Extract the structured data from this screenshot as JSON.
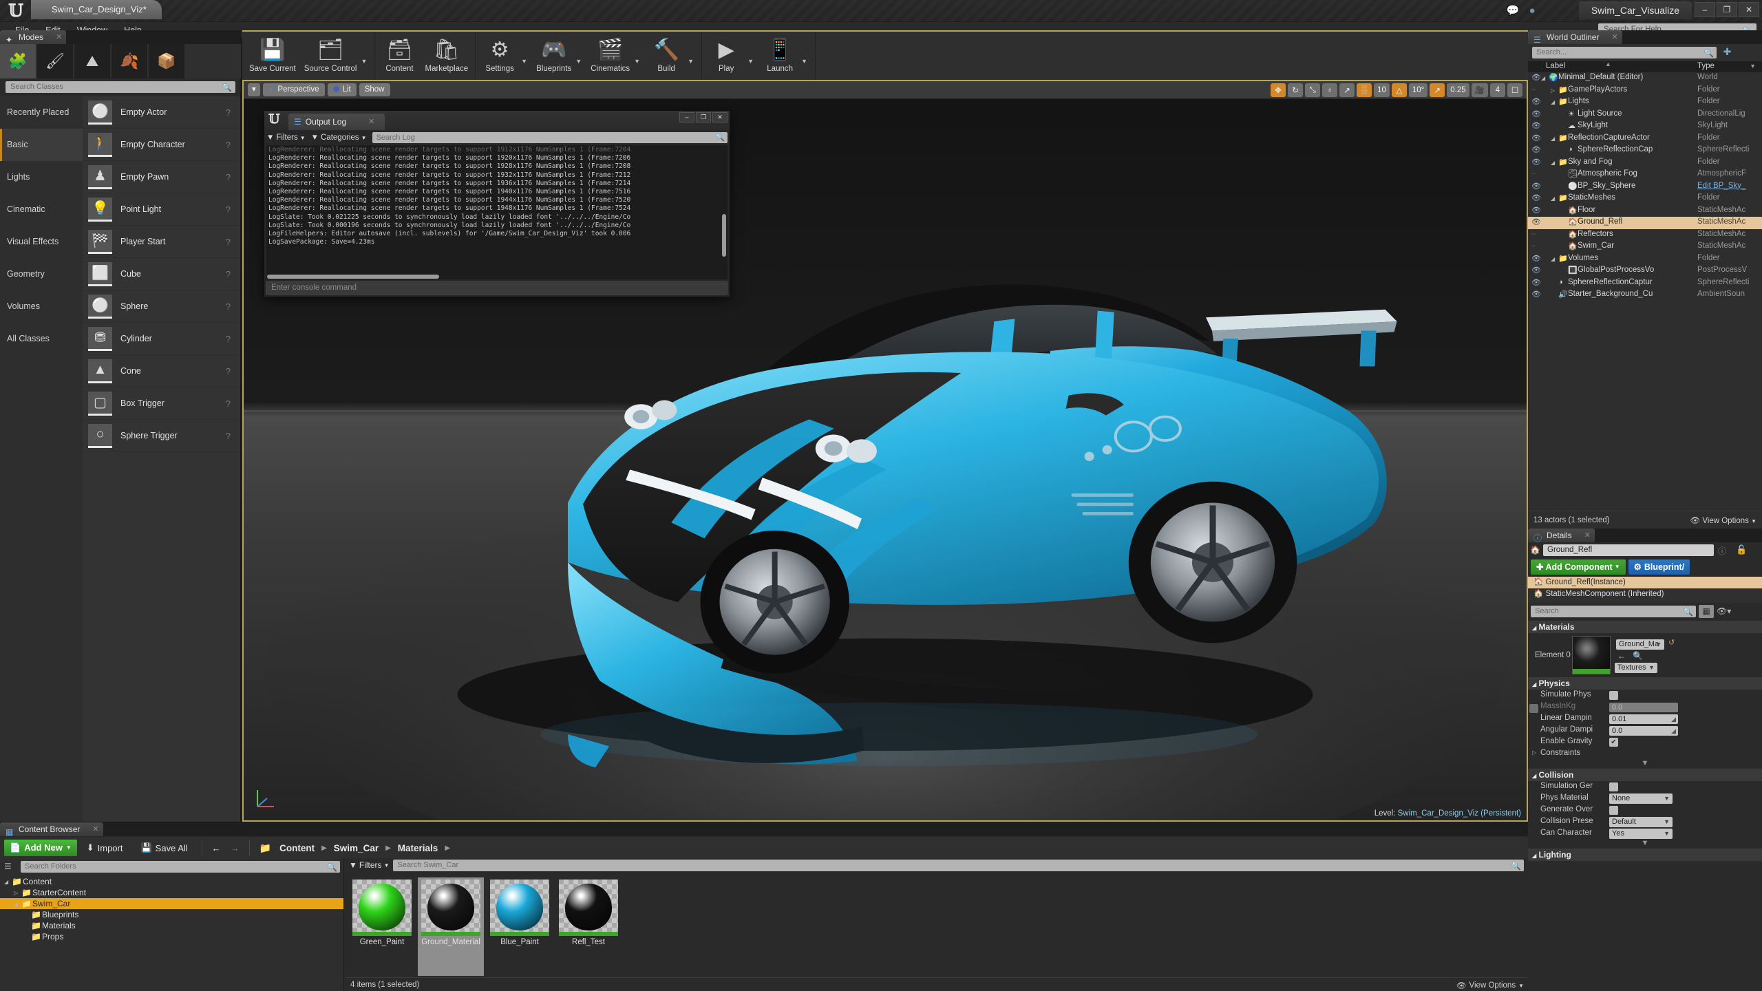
{
  "titlebar": {
    "project_tab": "Swim_Car_Design_Viz*",
    "app_tab": "Swim_Car_Visualize",
    "chat_icon": "speech-bubble-icon",
    "layers_icon": "layers-icon",
    "minimize": "–",
    "maximize": "❐",
    "close": "✕"
  },
  "menubar": {
    "items": [
      "File",
      "Edit",
      "Window",
      "Help"
    ],
    "help_search_placeholder": "Search For Help"
  },
  "modes": {
    "tab_label": "Modes",
    "mode_buttons": [
      "place-mode-icon",
      "paint-mode-icon",
      "landscape-mode-icon",
      "foliage-mode-icon",
      "geometry-mode-icon"
    ],
    "selected_mode_index": 0,
    "search_placeholder": "Search Classes",
    "categories": [
      "Recently Placed",
      "Basic",
      "Lights",
      "Cinematic",
      "Visual Effects",
      "Geometry",
      "Volumes",
      "All Classes"
    ],
    "selected_category": "Basic",
    "placeables": [
      {
        "label": "Empty Actor",
        "icon": "sphere-thumb-icon"
      },
      {
        "label": "Empty Character",
        "icon": "character-thumb-icon"
      },
      {
        "label": "Empty Pawn",
        "icon": "pawn-thumb-icon"
      },
      {
        "label": "Point Light",
        "icon": "bulb-thumb-icon"
      },
      {
        "label": "Player Start",
        "icon": "playerstart-thumb-icon"
      },
      {
        "label": "Cube",
        "icon": "cube-thumb-icon"
      },
      {
        "label": "Sphere",
        "icon": "sphere2-thumb-icon"
      },
      {
        "label": "Cylinder",
        "icon": "cylinder-thumb-icon"
      },
      {
        "label": "Cone",
        "icon": "cone-thumb-icon"
      },
      {
        "label": "Box Trigger",
        "icon": "boxtrigger-thumb-icon"
      },
      {
        "label": "Sphere Trigger",
        "icon": "spheretrigger-thumb-icon"
      }
    ]
  },
  "toolbar": {
    "groups": [
      {
        "items": [
          {
            "label": "Save Current",
            "icon": "floppy-disk-icon",
            "arrow": false
          },
          {
            "label": "Source Control",
            "icon": "source-control-icon",
            "arrow": true
          }
        ]
      },
      {
        "items": [
          {
            "label": "Content",
            "icon": "content-icon",
            "arrow": false
          },
          {
            "label": "Marketplace",
            "icon": "marketplace-bag-icon",
            "arrow": false
          }
        ]
      },
      {
        "items": [
          {
            "label": "Settings",
            "icon": "gear-icon",
            "arrow": true
          },
          {
            "label": "Blueprints",
            "icon": "blueprint-icon",
            "arrow": true
          },
          {
            "label": "Cinematics",
            "icon": "clapperboard-icon",
            "arrow": true
          },
          {
            "label": "Build",
            "icon": "build-icon",
            "arrow": true
          }
        ]
      },
      {
        "items": [
          {
            "label": "Play",
            "icon": "play-icon",
            "arrow": true
          },
          {
            "label": "Launch",
            "icon": "launch-icon",
            "arrow": true
          }
        ]
      }
    ]
  },
  "viewport": {
    "perspective_label": "Perspective",
    "lit_label": "Lit",
    "show_label": "Show",
    "menu_arrow": "▾",
    "transform_tools": [
      {
        "name": "translate-tool",
        "glyph": "✥",
        "active": true
      },
      {
        "name": "rotate-tool",
        "glyph": "↻",
        "active": false
      },
      {
        "name": "scale-tool",
        "glyph": "⤡",
        "active": false
      }
    ],
    "coord_system": {
      "name": "world-coord-toggle",
      "glyph": "♁"
    },
    "surface_snap": {
      "name": "surface-snap-toggle",
      "glyph": "↗"
    },
    "grid_snap": {
      "name": "grid-snap-toggle",
      "glyph": "░",
      "active": true
    },
    "grid_value": "10",
    "rotation_snap": {
      "name": "rotation-snap-toggle",
      "glyph": "△",
      "active": true
    },
    "rotation_value": "10°",
    "scale_snap": {
      "name": "scale-snap-toggle",
      "glyph": "↗",
      "active": true
    },
    "scale_value": "0.25",
    "camera_speed_icon": "camera-speed-icon",
    "camera_speed_value": "4",
    "maximize_icon": "maximize-viewport-icon",
    "level_prefix": "Level:",
    "level_name": "Swim_Car_Design_Viz (Persistent)"
  },
  "output_log": {
    "window_title": "Output Log",
    "filters_label": "Filters",
    "categories_label": "Categories",
    "search_placeholder": "Search Log",
    "console_placeholder": "Enter console command",
    "window_buttons": {
      "min": "–",
      "max": "❐",
      "close": "✕"
    },
    "lines": [
      "LogRenderer: Reallocating scene render targets to support 1912x1176 NumSamples 1 (Frame:7204",
      "LogRenderer: Reallocating scene render targets to support 1920x1176 NumSamples 1 (Frame:7206",
      "LogRenderer: Reallocating scene render targets to support 1928x1176 NumSamples 1 (Frame:7208",
      "LogRenderer: Reallocating scene render targets to support 1932x1176 NumSamples 1 (Frame:7212",
      "LogRenderer: Reallocating scene render targets to support 1936x1176 NumSamples 1 (Frame:7214",
      "LogRenderer: Reallocating scene render targets to support 1940x1176 NumSamples 1 (Frame:7516",
      "LogRenderer: Reallocating scene render targets to support 1944x1176 NumSamples 1 (Frame:7520",
      "LogRenderer: Reallocating scene render targets to support 1948x1176 NumSamples 1 (Frame:7524",
      "LogSlate: Took 0.021225 seconds to synchronously load lazily loaded font '../../../Engine/Co",
      "LogSlate: Took 0.000196 seconds to synchronously load lazily loaded font '../../../Engine/Co",
      "LogFileHelpers: Editor autosave (incl. sublevels) for '/Game/Swim_Car_Design_Viz' took 0.006",
      "LogSavePackage: Save=4.23ms"
    ]
  },
  "world_outliner": {
    "tab_label": "World Outliner",
    "search_placeholder": "Search...",
    "add_icon": "add-actor-icon",
    "columns": {
      "label": "Label",
      "type": "Type"
    },
    "rows": [
      {
        "label": "Minimal_Default (Editor)",
        "type": "World",
        "depth": 0,
        "icon": "world-icon",
        "expander": "◢",
        "visible": true,
        "selected": false
      },
      {
        "label": "GamePlayActors",
        "type": "Folder",
        "depth": 1,
        "icon": "folder-icon",
        "expander": "▷",
        "visible": false,
        "selected": false
      },
      {
        "label": "Lights",
        "type": "Folder",
        "depth": 1,
        "icon": "folder-icon",
        "expander": "◢",
        "visible": true,
        "selected": false
      },
      {
        "label": "Light Source",
        "type": "DirectionalLig",
        "depth": 2,
        "icon": "directional-light-icon",
        "expander": "",
        "visible": true,
        "selected": false
      },
      {
        "label": "SkyLight",
        "type": "SkyLight",
        "depth": 2,
        "icon": "sky-light-icon",
        "expander": "",
        "visible": true,
        "selected": false
      },
      {
        "label": "ReflectionCaptureActor",
        "type": "Folder",
        "depth": 1,
        "icon": "folder-icon",
        "expander": "◢",
        "visible": true,
        "selected": false
      },
      {
        "label": "SphereReflectionCap",
        "type": "SphereReflecti",
        "depth": 2,
        "icon": "reflection-capture-icon",
        "expander": "",
        "visible": true,
        "selected": false
      },
      {
        "label": "Sky and Fog",
        "type": "Folder",
        "depth": 1,
        "icon": "folder-icon",
        "expander": "◢",
        "visible": true,
        "selected": false
      },
      {
        "label": "Atmospheric Fog",
        "type": "AtmosphericF",
        "depth": 2,
        "icon": "fog-icon",
        "expander": "",
        "visible": false,
        "selected": false
      },
      {
        "label": "BP_Sky_Sphere",
        "type": "Edit BP_Sky_",
        "depth": 2,
        "icon": "sky-sphere-icon",
        "expander": "",
        "visible": true,
        "selected": false,
        "type_is_link": true
      },
      {
        "label": "StaticMeshes",
        "type": "Folder",
        "depth": 1,
        "icon": "folder-icon",
        "expander": "◢",
        "visible": true,
        "selected": false
      },
      {
        "label": "Floor",
        "type": "StaticMeshAc",
        "depth": 2,
        "icon": "static-mesh-icon",
        "expander": "",
        "visible": true,
        "selected": false
      },
      {
        "label": "Ground_Refl",
        "type": "StaticMeshAc",
        "depth": 2,
        "icon": "static-mesh-icon",
        "expander": "",
        "visible": true,
        "selected": true
      },
      {
        "label": "Reflectors",
        "type": "StaticMeshAc",
        "depth": 2,
        "icon": "static-mesh-icon",
        "expander": "",
        "visible": false,
        "selected": false
      },
      {
        "label": "Swim_Car",
        "type": "StaticMeshAc",
        "depth": 2,
        "icon": "static-mesh-icon",
        "expander": "",
        "visible": false,
        "selected": false
      },
      {
        "label": "Volumes",
        "type": "Folder",
        "depth": 1,
        "icon": "folder-icon",
        "expander": "◢",
        "visible": true,
        "selected": false
      },
      {
        "label": "GlobalPostProcessVo",
        "type": "PostProcessV",
        "depth": 2,
        "icon": "post-process-icon",
        "expander": "",
        "visible": true,
        "selected": false
      },
      {
        "label": "SphereReflectionCaptur",
        "type": "SphereReflecti",
        "depth": 1,
        "icon": "reflection-capture-icon",
        "expander": "",
        "visible": true,
        "selected": false
      },
      {
        "label": "Starter_Background_Cu",
        "type": "AmbientSoun",
        "depth": 1,
        "icon": "ambient-sound-icon",
        "expander": "",
        "visible": true,
        "selected": false
      }
    ],
    "footer_count": "13 actors (1 selected)",
    "view_options_label": "View Options",
    "view_options_icon": "eye-icon"
  },
  "details": {
    "tab_label": "Details",
    "actor_icon": "static-mesh-icon",
    "actor_name": "Ground_Refl",
    "help_icon": "help-icon",
    "lock_icon": "lock-icon",
    "add_component_label": "Add Component",
    "blueprint_label": "Blueprint/",
    "tree": [
      {
        "label": "Ground_Refl(Instance)",
        "selected": true,
        "icon": "static-mesh-icon"
      },
      {
        "label": "StaticMeshComponent (Inherited)",
        "selected": false,
        "icon": "static-mesh-icon"
      }
    ],
    "search_placeholder": "Search",
    "grid_view_icon": "grid-view-icon",
    "eye_icon": "eye-icon",
    "sections": [
      {
        "title": "Materials",
        "material": {
          "element_label": "Element 0",
          "value": "Ground_Ma",
          "textures_label": "Textures",
          "reset_icon": "reset-icon",
          "browse_icon": "browse-icon",
          "search_icon": "search-icon"
        }
      },
      {
        "title": "Physics",
        "rows": [
          {
            "label": "Simulate Phys",
            "type": "checkbox",
            "checked": false,
            "disabled": false
          },
          {
            "label": "MassInKg",
            "type": "checkbox-value",
            "checked": false,
            "disabled": true,
            "value": "0.0"
          },
          {
            "label": "Linear Dampin",
            "type": "number",
            "value": "0.01"
          },
          {
            "label": "Angular Dampi",
            "type": "number",
            "value": "0.0"
          },
          {
            "label": "Enable Gravity",
            "type": "checkbox",
            "checked": true,
            "disabled": false
          },
          {
            "label": "Constraints",
            "type": "group"
          }
        ]
      },
      {
        "title": "Collision",
        "rows": [
          {
            "label": "Simulation Ger",
            "type": "checkbox",
            "checked": false,
            "disabled": false
          },
          {
            "label": "Phys Material",
            "type": "dropdown",
            "value": "None"
          },
          {
            "label": "Generate Over",
            "type": "checkbox",
            "checked": false,
            "disabled": false
          },
          {
            "label": "Collision Prese",
            "type": "dropdown",
            "value": "Default"
          },
          {
            "label": "Can Character",
            "type": "dropdown",
            "value": "Yes"
          }
        ]
      },
      {
        "title": "Lighting",
        "rows": []
      }
    ]
  },
  "content_browser": {
    "tab_label": "Content Browser",
    "add_new_label": "Add New",
    "import_label": "Import",
    "save_all_label": "Save All",
    "back_arrow": "←",
    "forward_arrow": "→",
    "breadcrumbs": [
      "Content",
      "Swim_Car",
      "Materials"
    ],
    "folder_search_placeholder": "Search Folders",
    "folders": [
      {
        "label": "Content",
        "depth": 0,
        "expander": "◢",
        "selected": false
      },
      {
        "label": "StarterContent",
        "depth": 1,
        "expander": "▷",
        "selected": false
      },
      {
        "label": "Swim_Car",
        "depth": 1,
        "expander": "◢",
        "selected": true
      },
      {
        "label": "Blueprints",
        "depth": 2,
        "expander": "",
        "selected": false
      },
      {
        "label": "Materials",
        "depth": 2,
        "expander": "",
        "selected": false
      },
      {
        "label": "Props",
        "depth": 2,
        "expander": "",
        "selected": false
      }
    ],
    "filters_label": "Filters",
    "asset_search_placeholder": "Search Swim_Car",
    "assets": [
      {
        "name": "Green_Paint",
        "color": "#2fd41a",
        "selected": false
      },
      {
        "name": "Ground_Material",
        "color": "#1a1a1a",
        "selected": true
      },
      {
        "name": "Blue_Paint",
        "color": "#1aa8d8",
        "selected": false
      },
      {
        "name": "Refl_Test",
        "color": "#111111",
        "selected": false
      }
    ],
    "status": "4 items (1 selected)",
    "view_options_label": "View Options",
    "view_options_icon": "eye-icon"
  },
  "colors": {
    "accent_orange": "#d4882a",
    "selection_tan": "#e6c79c",
    "folder_selected": "#e8a317",
    "green_button": "#42a832",
    "blue_button": "#2a78c8",
    "car_blue": "#1c9fd0",
    "link_blue": "#7fb2de"
  }
}
